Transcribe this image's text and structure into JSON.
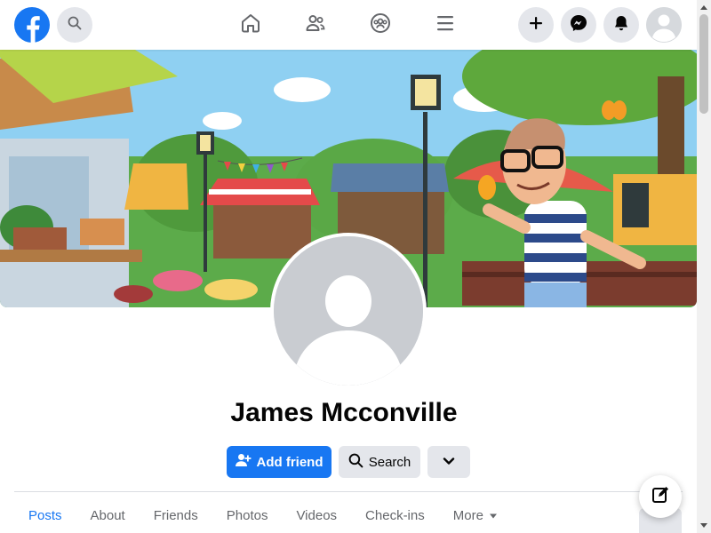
{
  "topnav": {
    "logo_icon": "facebook-logo-icon",
    "search_icon": "search-icon",
    "nav_items": [
      "home-icon",
      "friends-icon",
      "groups-icon",
      "menu-icon"
    ],
    "right_buttons": [
      "plus-icon",
      "messenger-icon",
      "bell-icon",
      "account-avatar"
    ]
  },
  "cover": {
    "image": "cover-photo-cartoon-market-scene"
  },
  "profile": {
    "name": "James Mcconville",
    "actions": {
      "add_friend_label": "Add friend",
      "search_label": "Search"
    }
  },
  "tabs": [
    {
      "label": "Posts",
      "active": true
    },
    {
      "label": "About",
      "active": false
    },
    {
      "label": "Friends",
      "active": false
    },
    {
      "label": "Photos",
      "active": false
    },
    {
      "label": "Videos",
      "active": false
    },
    {
      "label": "Check-ins",
      "active": false
    },
    {
      "label": "More",
      "active": false
    }
  ],
  "colors": {
    "brand": "#1877f2",
    "button_gray": "#e4e6eb",
    "text_primary": "#050505",
    "text_secondary": "#65676b"
  }
}
